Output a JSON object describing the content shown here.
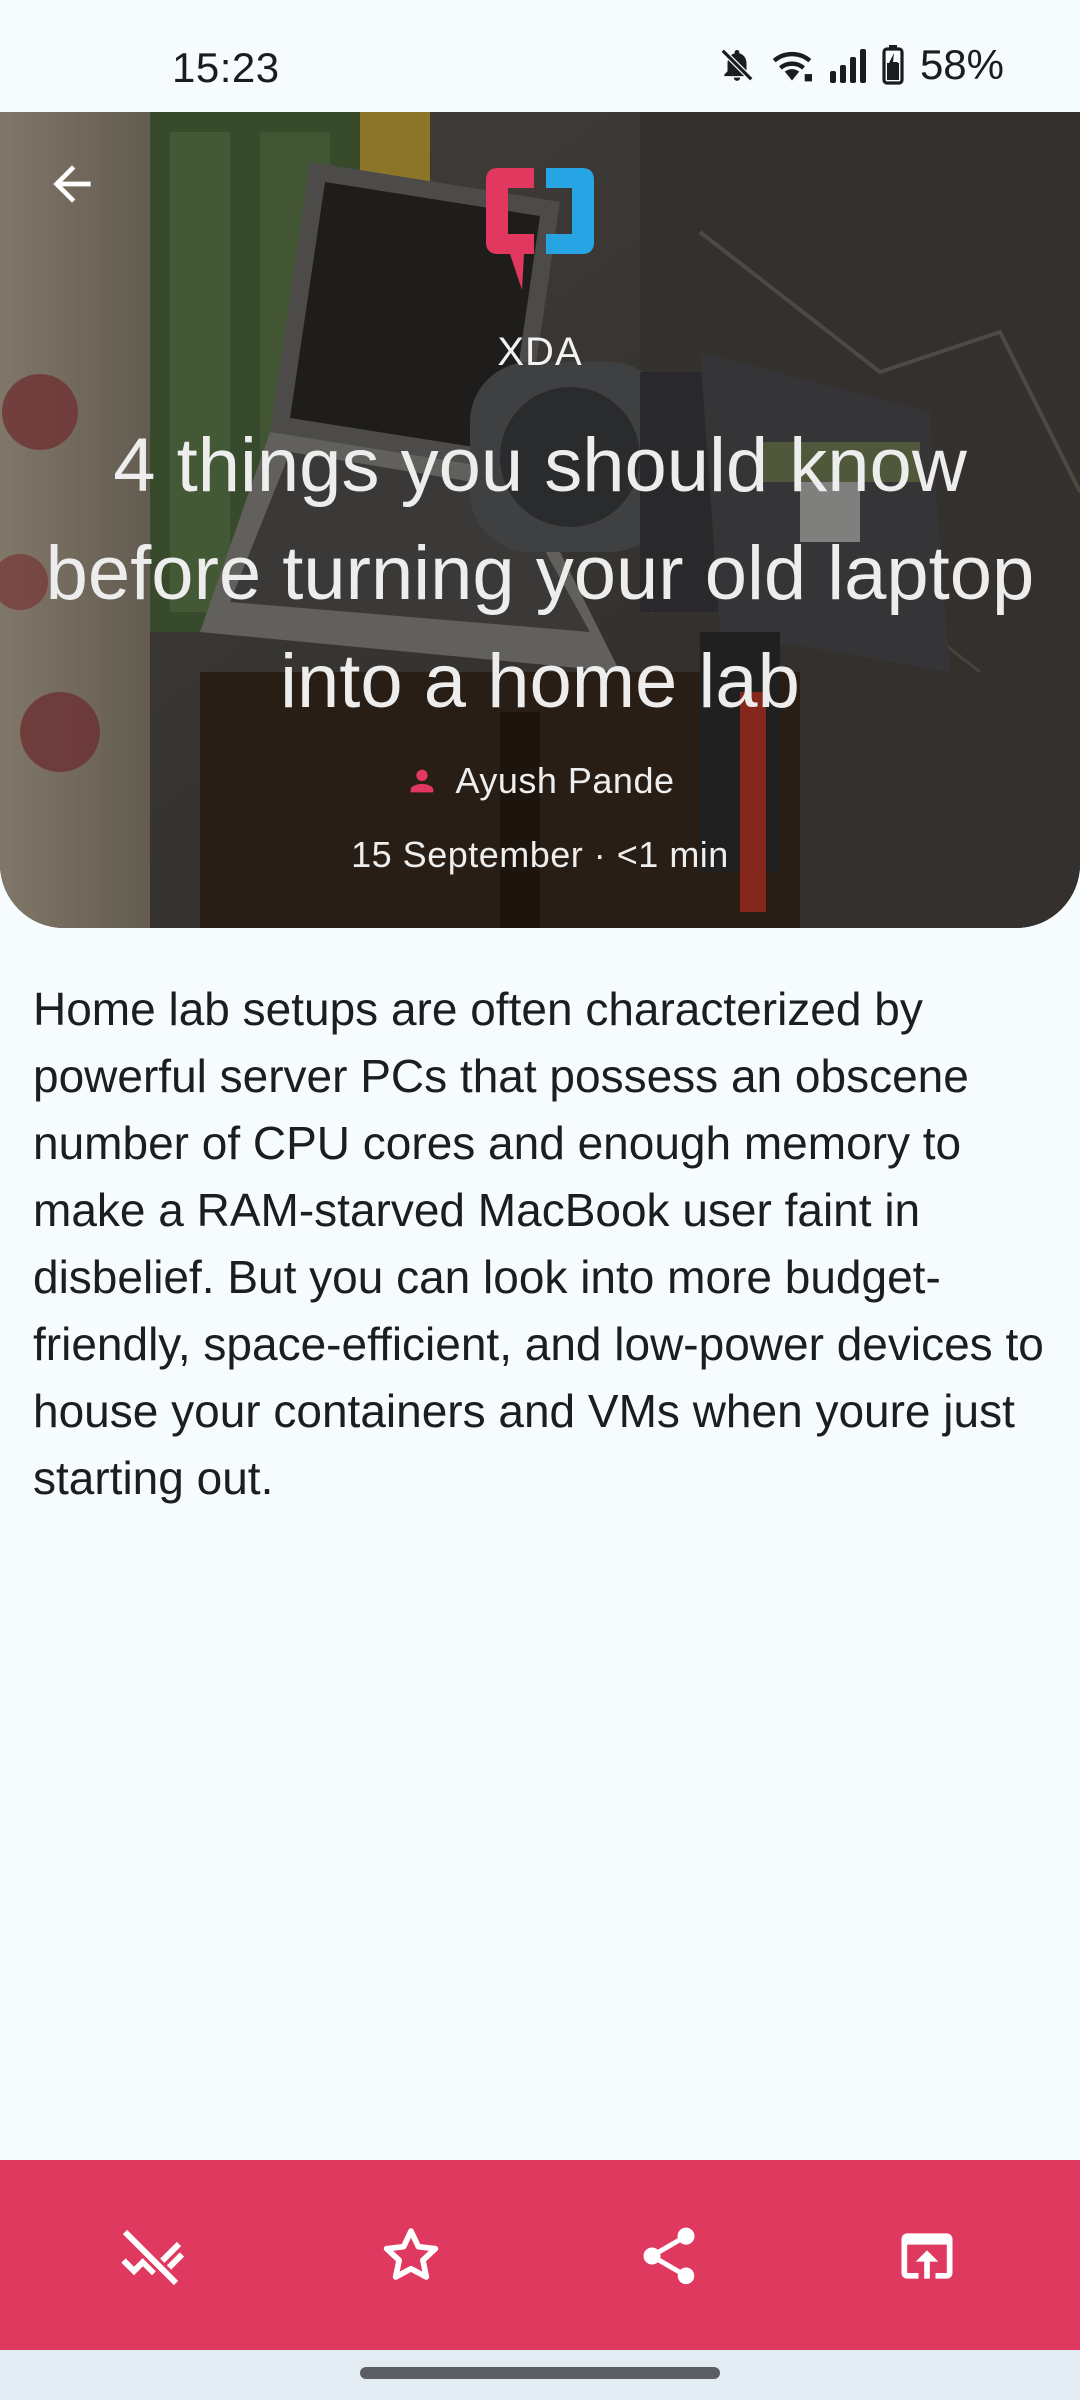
{
  "status_bar": {
    "time": "15:23",
    "battery": "58%",
    "icons": [
      "mute-bell-icon",
      "wifi-icon",
      "signal-icon",
      "battery-charging-icon"
    ]
  },
  "header": {
    "back_icon": "arrow-left-icon",
    "source_logo": "xda-logo",
    "source_name": "XDA",
    "title": "4 things you should know before turning your old laptop into a home lab",
    "author_icon": "person-icon",
    "author": "Ayush Pande",
    "meta": "15 September · <1 min"
  },
  "article": {
    "body": "Home lab setups are often characterized by powerful server PCs that possess an obscene number of CPU cores and enough memory to make a RAM-starved MacBook user faint in disbelief. But you can look into more budget-friendly, space-efficient, and low-power devices to house your containers and VMs when youre just starting out."
  },
  "action_bar": {
    "background": "#e0395f",
    "items": [
      {
        "icon": "mark-read-icon"
      },
      {
        "icon": "star-icon"
      },
      {
        "icon": "share-icon"
      },
      {
        "icon": "open-in-browser-icon"
      }
    ]
  },
  "colors": {
    "accent": "#e0395f",
    "logo_pink": "#e2375e",
    "logo_blue": "#27a4e4",
    "background": "#f6fbfe"
  }
}
